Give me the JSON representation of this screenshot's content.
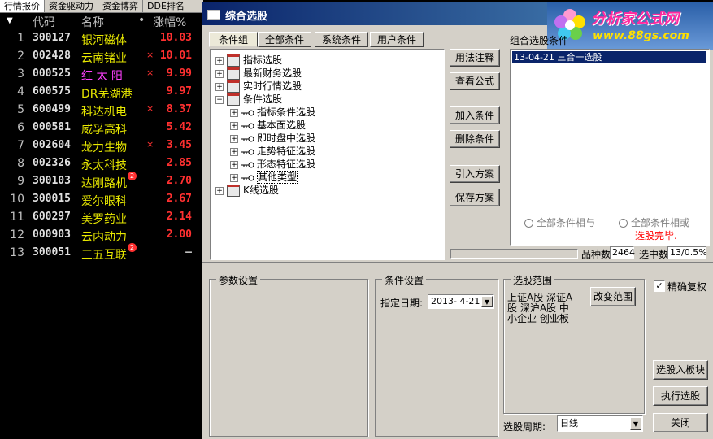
{
  "stock_list": {
    "tabs": [
      "行情报价",
      "资金驱动力",
      "资金博弈",
      "DDE排名"
    ],
    "headers": {
      "marker": "▼",
      "code": "代码",
      "name": "名称",
      "dot": "•",
      "pct": "涨幅%"
    },
    "rows": [
      {
        "idx": "1",
        "code": "300127",
        "name": "银河磁体",
        "mark": "",
        "pct": "10.03",
        "badge": ""
      },
      {
        "idx": "2",
        "code": "002428",
        "name": "云南锗业",
        "mark": "×",
        "pct": "10.01",
        "badge": ""
      },
      {
        "idx": "3",
        "code": "000525",
        "name": "红 太 阳",
        "mark": "×",
        "pct": "9.99",
        "badge": "",
        "name_color": "#ff40ff"
      },
      {
        "idx": "4",
        "code": "600575",
        "name": "DR芜湖港",
        "mark": "",
        "pct": "9.97",
        "badge": ""
      },
      {
        "idx": "5",
        "code": "600499",
        "name": "科达机电",
        "mark": "×",
        "pct": "8.37",
        "badge": ""
      },
      {
        "idx": "6",
        "code": "000581",
        "name": "威孚高科",
        "mark": "",
        "pct": "5.42",
        "badge": ""
      },
      {
        "idx": "7",
        "code": "002604",
        "name": "龙力生物",
        "mark": "×",
        "pct": "3.45",
        "badge": ""
      },
      {
        "idx": "8",
        "code": "002326",
        "name": "永太科技",
        "mark": "",
        "pct": "2.85",
        "badge": ""
      },
      {
        "idx": "9",
        "code": "300103",
        "name": "达刚路机",
        "mark": "",
        "pct": "2.70",
        "badge": "2"
      },
      {
        "idx": "10",
        "code": "300015",
        "name": "爱尔眼科",
        "mark": "",
        "pct": "2.67",
        "badge": ""
      },
      {
        "idx": "11",
        "code": "600297",
        "name": "美罗药业",
        "mark": "",
        "pct": "2.14",
        "badge": ""
      },
      {
        "idx": "12",
        "code": "000903",
        "name": "云内动力",
        "mark": "",
        "pct": "2.00",
        "badge": ""
      },
      {
        "idx": "13",
        "code": "300051",
        "name": "三五互联",
        "mark": "",
        "pct": "—",
        "badge": "2"
      }
    ]
  },
  "dialog": {
    "title": "综合选股",
    "logo": {
      "main": "分析家公式网",
      "sub": "www.88gs.com"
    },
    "tabs": [
      "条件组",
      "全部条件",
      "系统条件",
      "用户条件"
    ],
    "tree": [
      {
        "label": "指标选股",
        "level": 0,
        "kind": "folder",
        "expander": "+"
      },
      {
        "label": "最新财务选股",
        "level": 0,
        "kind": "folder",
        "expander": "+"
      },
      {
        "label": "实时行情选股",
        "level": 0,
        "kind": "folder",
        "expander": "+"
      },
      {
        "label": "条件选股",
        "level": 0,
        "kind": "folder",
        "expander": "−"
      },
      {
        "label": "指标条件选股",
        "level": 1,
        "kind": "key",
        "expander": "+"
      },
      {
        "label": "基本面选股",
        "level": 1,
        "kind": "key",
        "expander": "+"
      },
      {
        "label": "即时盘中选股",
        "level": 1,
        "kind": "key",
        "expander": "+"
      },
      {
        "label": "走势特征选股",
        "level": 1,
        "kind": "key",
        "expander": "+"
      },
      {
        "label": "形态特征选股",
        "level": 1,
        "kind": "key",
        "expander": "+"
      },
      {
        "label": "其他类型",
        "level": 1,
        "kind": "key",
        "expander": "+"
      },
      {
        "label": "K线选股",
        "level": 0,
        "kind": "folder",
        "expander": "+"
      }
    ],
    "buttons": {
      "usage": "用法注释",
      "view_formula": "查看公式",
      "add_condition": "加入条件",
      "delete_condition": "删除条件",
      "import_plan": "引入方案",
      "save_plan": "保存方案",
      "change_range": "改变范围",
      "to_block": "选股入板块",
      "execute": "执行选股",
      "close": "关闭"
    },
    "combo_label": "组合选股条件",
    "combo_items": [
      "13-04-21 三合一选股"
    ],
    "radio_all_and": "全部条件相与",
    "radio_all_or": "全部条件相或",
    "status_text": "选股完毕.",
    "variety_label": "品种数",
    "variety_value": "2464",
    "selected_label": "选中数",
    "selected_value": "13/0.5%",
    "param_group": "参数设置",
    "cond_group": "条件设置",
    "date_label": "指定日期:",
    "date_value": "2013- 4-21",
    "range_group": "选股范围",
    "range_text": "上证A股 深证A股 深沪A股 中小企业 创业板",
    "precise_label": "精确复权",
    "precise_checked": true,
    "period_label": "选股周期:",
    "period_value": "日线"
  },
  "colors": {
    "title_bar": "#0a246a",
    "selection": "#0a246a",
    "stock_up": "#ff3030",
    "stock_name": "#e8e800",
    "status_red": "#ff0000"
  }
}
